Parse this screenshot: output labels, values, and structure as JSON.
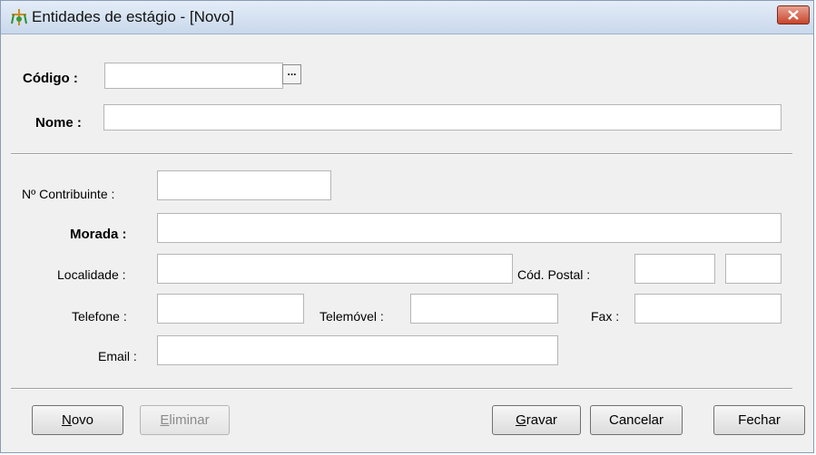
{
  "window": {
    "title": "Entidades de estágio - [Novo]",
    "close_icon": "close-x-icon",
    "app_icon": "entity-tree-icon"
  },
  "top_section": {
    "codigo_label": "Código :",
    "codigo_value": "",
    "lookup_button": "...",
    "nome_label": "Nome :",
    "nome_value": ""
  },
  "details": {
    "contribuinte_label": "Nº Contribuinte :",
    "contribuinte_value": "",
    "morada_label": "Morada :",
    "morada_value": "",
    "localidade_label": "Localidade :",
    "localidade_value": "",
    "cod_postal_label": "Cód. Postal :",
    "cod_postal_value_1": "",
    "cod_postal_value_2": "",
    "telefone_label": "Telefone :",
    "telefone_value": "",
    "telemovel_label": "Telemóvel :",
    "telemovel_value": "",
    "fax_label": "Fax :",
    "fax_value": "",
    "email_label": "Email :",
    "email_value": ""
  },
  "buttons": {
    "novo_first": "N",
    "novo_rest": "ovo",
    "eliminar_first": "E",
    "eliminar_rest": "liminar",
    "gravar_first": "G",
    "gravar_rest": "ravar",
    "cancelar": "Cancelar",
    "fechar": "Fechar"
  },
  "colors": {
    "window_bg": "#f0f0f0",
    "titlebar": "#c9d8ec",
    "close_button": "#c8452c"
  }
}
